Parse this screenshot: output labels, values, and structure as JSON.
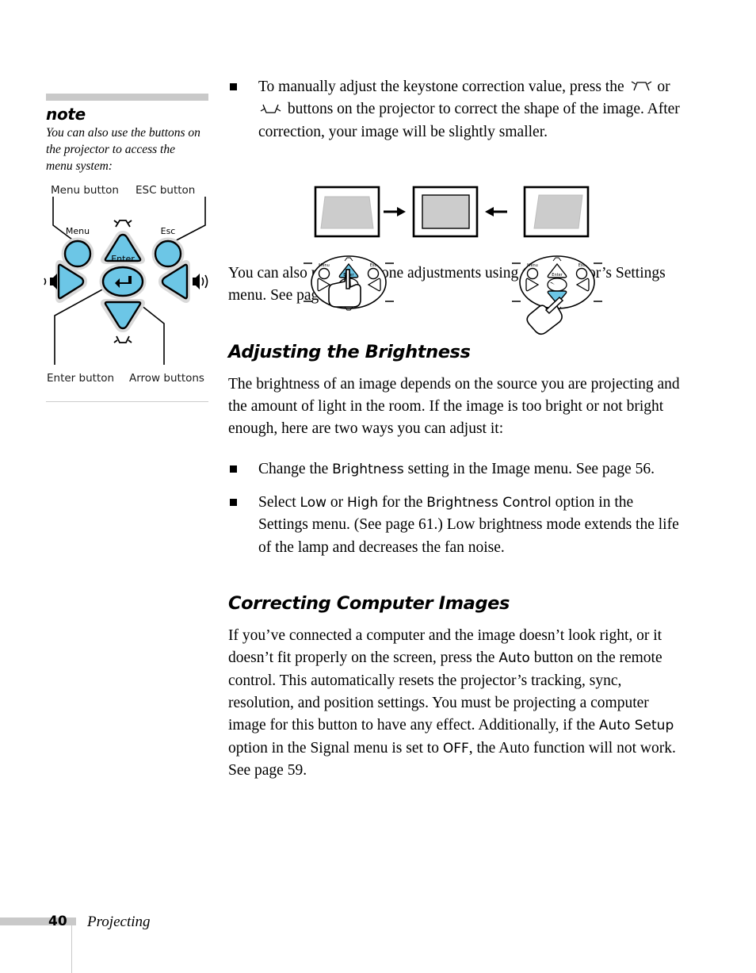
{
  "note": {
    "heading": "note",
    "body": "You can also use the buttons on the projector to access the menu system:",
    "callouts": {
      "menu": "Menu button",
      "esc": "ESC button",
      "enter": "Enter button",
      "arrows": "Arrow buttons"
    },
    "panel_labels": {
      "menu": "Menu",
      "esc": "Esc",
      "enter": "Enter"
    }
  },
  "main": {
    "bullet_keystone": {
      "text_1": "To manually adjust the keystone correction value, press the",
      "icon_1": "keystone-up-icon",
      "conjunction": "or",
      "icon_2": "keystone-down-icon",
      "text_2": "buttons on the projector to correct the shape of the image. After correction, your image will be slightly smaller."
    },
    "paragraph_settings": "You can also make keystone adjustments using the projector’s Settings menu. See page 61.",
    "section_brightness": {
      "heading": "Adjusting the Brightness",
      "intro": "The brightness of an image depends on the source you are projecting and the amount of light in the room. If the image is too bright or not bright enough, here are two ways you can adjust it:",
      "bullet_1": {
        "before": "Change the ",
        "term": "Brightness",
        "after": " setting in the Image menu. See page 56."
      },
      "bullet_2": {
        "part_1": "Select ",
        "term_1": "Low",
        "part_2": " or ",
        "term_2": "High",
        "part_3": " for the ",
        "term_3": "Brightness Control",
        "part_4": " option in the Settings menu. (See page 61.) Low brightness mode extends the life of the lamp and decreases the fan noise."
      }
    },
    "section_correcting": {
      "heading": "Correcting Computer Images",
      "part_1": "If you’ve connected a computer and the image doesn’t look right, or it doesn’t fit properly on the screen, press the ",
      "term_1": "Auto",
      "part_2": " button on the remote control. This automatically resets the projector’s tracking, sync, resolution, and position settings. You must be projecting a computer image for this button to have any effect. Additionally, if the ",
      "term_2": "Auto Setup",
      "part_3": " option in the Signal menu is set to ",
      "term_3": "OFF",
      "part_4": ", the Auto function will not work. See page 59."
    }
  },
  "figure": {
    "left_screen": "keystone-narrow-top-trapezoid",
    "center_screen": "corrected-rectangle",
    "right_screen": "keystone-wide-top-trapezoid",
    "arrow_left": "arrow-right-icon",
    "arrow_right": "arrow-left-icon",
    "left_panel": "projector-panel-press-up-arrow",
    "right_panel": "projector-panel-press-down-arrow",
    "panel_labels": {
      "menu": "Menu",
      "esc": "Esc",
      "enter": "Enter"
    }
  },
  "footer": {
    "page_number": "40",
    "chapter": "Projecting"
  },
  "colors": {
    "button_blue": "#6CC6E6",
    "rule_gray": "#c9c9c9",
    "screen_gray": "#cccccc"
  }
}
